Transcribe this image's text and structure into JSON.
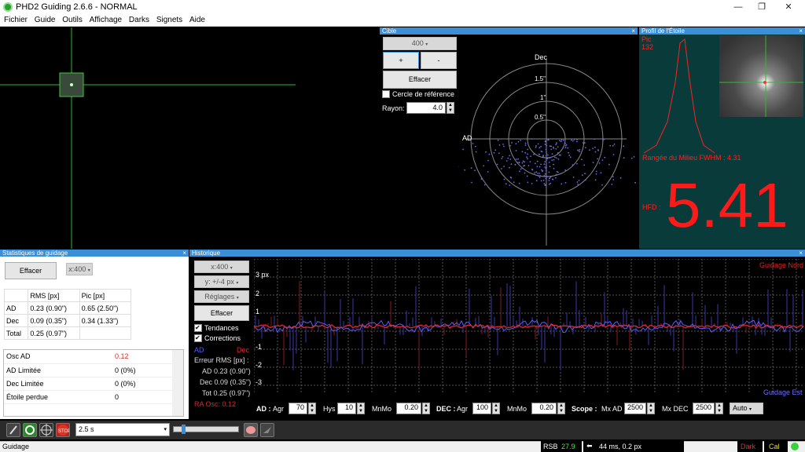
{
  "window": {
    "title": "PHD2 Guiding 2.6.6 - NORMAL",
    "minimize": "—",
    "maximize": "❐",
    "close": "✕"
  },
  "menu": [
    "Fichier",
    "Guide",
    "Outils",
    "Affichage",
    "Darks",
    "Signets",
    "Aide"
  ],
  "target": {
    "title": "Cible",
    "scale": "400",
    "plus": "+",
    "minus": "-",
    "clear": "Effacer",
    "ref_circle": "Cercle de référence",
    "radius_label": "Rayon:",
    "radius_value": "4.0",
    "dec_label": "Dec",
    "ra_label": "AD",
    "rings": [
      "1.5\"",
      "1\"",
      "0.5\""
    ]
  },
  "profile": {
    "title": "Profil de l'Étoile",
    "peak_label": "Pic",
    "peak_value": "132",
    "fwhm": "Rangée du Milieu FWHM : 4.31",
    "hfd_label": "HFD :",
    "hfd_value": "5.41"
  },
  "stats": {
    "title": "Statistiques de guidage",
    "clear": "Effacer",
    "scale": "x:400",
    "headers": [
      "",
      "RMS [px]",
      "Pic [px]"
    ],
    "rows": [
      [
        "AD",
        "0.23 (0.90\")",
        "0.65 (2.50\")"
      ],
      [
        "Dec",
        "0.09 (0.35\")",
        "0.34 (1.33\")"
      ],
      [
        "Total",
        "0.25 (0.97\")",
        ""
      ]
    ],
    "rows2": [
      [
        "Osc AD",
        "0.12"
      ],
      [
        "AD Limitée",
        "0 (0%)"
      ],
      [
        "Dec Limitée",
        "0 (0%)"
      ],
      [
        "Étoile perdue",
        "0"
      ]
    ]
  },
  "history": {
    "title": "Historique",
    "xscale": "x:400",
    "yscale": "y: +/-4 px",
    "settings": "Réglages",
    "clear": "Effacer",
    "trends": "Tendances",
    "corrections": "Corrections",
    "ad": "AD",
    "dec": "Dec",
    "rms_title": "Erreur RMS [px] :",
    "rms_ad": "AD 0.23 (0.90\")",
    "rms_dec": "Dec 0.09 (0.35\")",
    "rms_tot": "Tot 0.25 (0.97\")",
    "ra_osc": "RA Osc: 0.12",
    "north": "Guidage Nord",
    "east": "Guidage Est",
    "ylabels": [
      "3 px",
      "2",
      "1",
      "-1",
      "-2",
      "-3"
    ]
  },
  "controls": {
    "ad": "AD :",
    "agr": "Agr",
    "ad_agr": "70",
    "hys": "Hys",
    "ad_hys": "10",
    "mnmo": "MnMo",
    "ad_mnmo": "0.20",
    "dec": "DEC :",
    "dec_agr": "100",
    "dec_mnmo": "0.20",
    "scope": "Scope :",
    "mxad": "Mx AD",
    "mxad_val": "2500",
    "mxdec": "Mx DEC",
    "mxdec_val": "2500",
    "auto": "Auto"
  },
  "toolbar": {
    "exposure": "2.5 s"
  },
  "status": {
    "left": "Guidage",
    "rsb_label": "RSB",
    "rsb_value": "27.9",
    "guide": "44 ms, 0.2 px",
    "dark": "Dark",
    "cal": "Cal"
  },
  "colors": {
    "ra": "#4f4fd6",
    "dec": "#d62828",
    "panel": "#3b8fd6"
  }
}
